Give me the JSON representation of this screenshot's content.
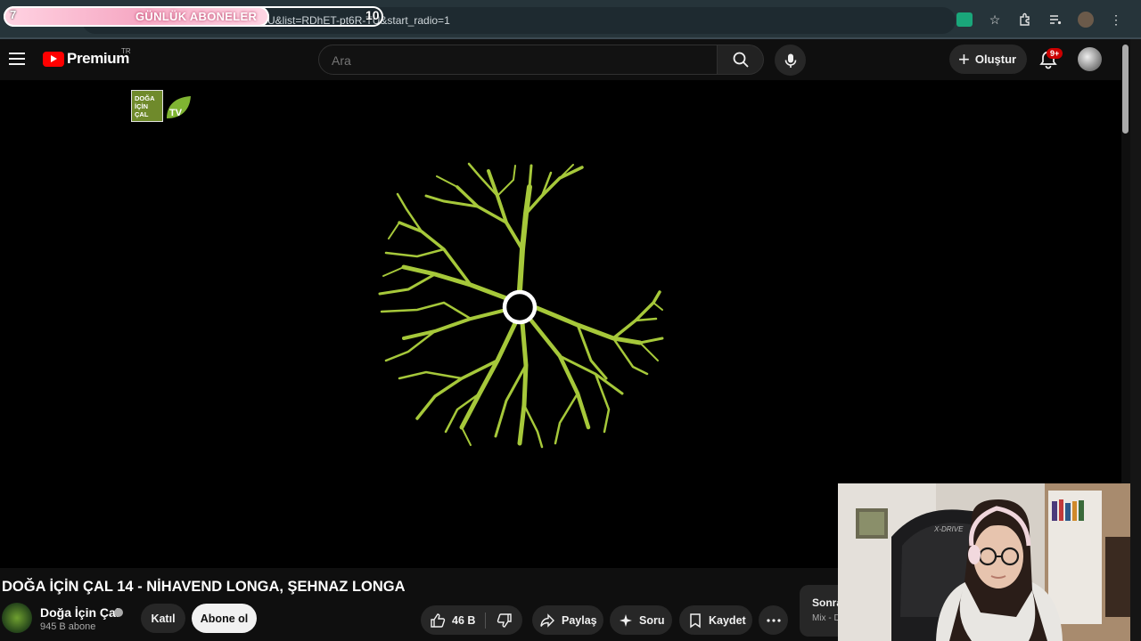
{
  "browser": {
    "url_fragment": "U&list=RDhET-pt6R-TU&start_radio=1",
    "overlay": {
      "left_count": "7",
      "title": "GÜNLÜK ABONELER",
      "goal": "10",
      "progress": 0.7
    }
  },
  "header": {
    "logo_text": "Premium",
    "region": "TR",
    "search_placeholder": "Ara",
    "create_label": "Oluştur",
    "notification_badge": "9+"
  },
  "player": {
    "watermark_lines": [
      "DOĞA",
      "İÇİN",
      "ÇAL"
    ],
    "watermark_tv": "TV"
  },
  "video": {
    "title": "DOĞA İÇİN ÇAL 14 - NİHAVEND LONGA, ŞEHNAZ LONGA",
    "channel_name": "Doğa İçin Çal",
    "subscribers": "945 B abone",
    "join_label": "Katıl",
    "subscribe_label": "Abone ol",
    "like_count": "46 B",
    "share_label": "Paylaş",
    "ask_label": "Soru",
    "save_label": "Kaydet"
  },
  "up_next": {
    "title": "Sonra",
    "subtitle": "Mix - D"
  },
  "colors": {
    "tree": "#a6c83a",
    "accent": "#ff0000",
    "background": "#0f0f0f"
  }
}
